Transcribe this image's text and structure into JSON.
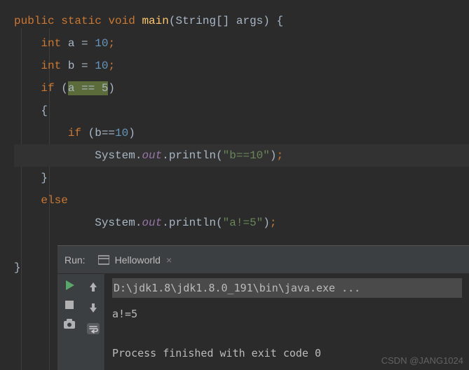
{
  "code": {
    "l1": {
      "public": "public",
      "static": "static",
      "void": "void",
      "main": "main",
      "args": "(String[] args) {"
    },
    "l2": {
      "int": "int",
      "rest": " a = ",
      "num": "10",
      "semi": ";"
    },
    "l3": {
      "int": "int",
      "rest": " b = ",
      "num": "10",
      "semi": ";"
    },
    "l4": {
      "if": "if",
      "open": " (",
      "sel": "a == 5",
      "close": ")"
    },
    "l5": {
      "brace": "{"
    },
    "l6": {
      "if": "if",
      "cond": " (b==",
      "num": "10",
      "close": ")"
    },
    "l7": {
      "sys": "System.",
      "out": "out",
      "print": ".println(",
      "str": "\"b==10\"",
      "end": ");"
    },
    "l8": {
      "brace": "}"
    },
    "l9": {
      "else": "else"
    },
    "l10": {
      "sys": "System.",
      "out": "out",
      "print": ".println(",
      "str": "\"a!=5\"",
      "end": ");"
    },
    "l12": {
      "brace": "}"
    }
  },
  "run": {
    "label": "Run:",
    "tab": "Helloworld",
    "cmd": "D:\\jdk1.8\\jdk1.8.0_191\\bin\\java.exe ...",
    "out1": "a!=5",
    "out2": "Process finished with exit code 0"
  },
  "watermark": "CSDN @JANG1024"
}
